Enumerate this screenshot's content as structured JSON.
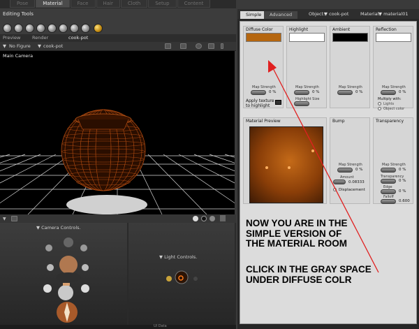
{
  "room_tabs": [
    "Pose",
    "Material",
    "Face",
    "Hair",
    "Cloth",
    "Setup",
    "Content"
  ],
  "active_room": "Material",
  "toolbar": {
    "title": "Editing Tools",
    "tools": [
      "rotate-tool-icon",
      "twist-tool-icon",
      "translate-tool-icon",
      "scale-tool-icon",
      "taper-tool-icon",
      "color-tool-icon",
      "view-magnifier-icon",
      "direct-manipulation-icon",
      "grouping-tool-icon"
    ]
  },
  "preview_tabs": {
    "preview": "Preview",
    "render": "Render",
    "document": "cook-pot"
  },
  "preview_bar": {
    "figure": "No Figure",
    "actor": "cook-pot"
  },
  "viewport": {
    "camera_name": "Main Camera",
    "background": "#000000",
    "grid_color": "#d8d8d8",
    "pot_color": "#b04a10"
  },
  "camera_controls": {
    "label": "Camera Controls."
  },
  "light_controls": {
    "label": "Light Controls."
  },
  "bottom_label": "UI Data",
  "material_panel": {
    "tabs": {
      "simple": "Simple",
      "advanced": "Advanced"
    },
    "object_label": "Object:",
    "object_value": "cook-pot",
    "material_label": "Material:",
    "material_value": "material01",
    "slots": {
      "diffuse": {
        "title": "Diffuse Color",
        "color": "#b5660f",
        "map_strength_label": "Map Strength",
        "value": "0 %"
      },
      "highlight": {
        "title": "Highlight",
        "color": "#ffffff",
        "map_strength_label": "Map Strength",
        "value": "0 %",
        "size_label": "Highlight Size"
      },
      "ambient": {
        "title": "Ambient",
        "color": "#000000",
        "map_strength_label": "Map Strength",
        "value": "0 %"
      },
      "reflection": {
        "title": "Reflection",
        "color": "#ffffff",
        "map_strength_label": "Map Strength",
        "value": "0 %",
        "multiply_label": "Multiply with:",
        "option1": "Lights",
        "option2": "Object color"
      },
      "apply_texture": "Apply texture\nto highlight",
      "preview": {
        "title": "Material Preview"
      },
      "bump": {
        "title": "Bump",
        "map_strength_label": "Map Strength",
        "value": "0 %",
        "amount_label": "Amount",
        "amount": "0.08333",
        "displacement": "Displacement"
      },
      "transparency": {
        "title": "Transparency",
        "map_strength_label": "Map Strength",
        "value": "0 %",
        "transparency_label": "Transparency",
        "transparency_value": "0 %",
        "edge_label": "Edge",
        "edge_value": "0 %",
        "falloff_label": "Falloff",
        "falloff_value": "0.600"
      }
    }
  },
  "instructions": {
    "line1": "NOW YOU ARE IN THE",
    "line2": "SIMPLE VERSION OF",
    "line3": "THE MATERIAL ROOM",
    "line4": "CLICK IN THE GRAY SPACE",
    "line5": "UNDER DIFFUSE COLR",
    "arrow_color": "#e02020"
  }
}
